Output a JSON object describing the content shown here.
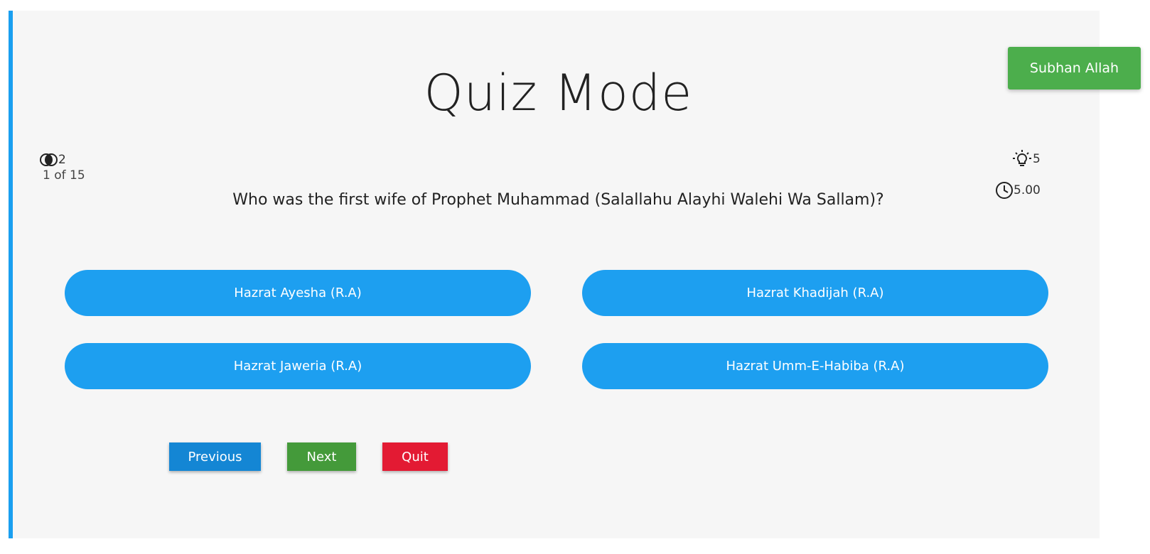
{
  "quiz": {
    "title": "Quiz Mode",
    "attempts": "2",
    "hints": "5",
    "progress": "1 of 15",
    "timer": "5.00",
    "question": "Who was the first wife of Prophet Muhammad (Salallahu Alayhi Walehi Wa Sallam)?",
    "options": [
      "Hazrat Ayesha (R.A)",
      "Hazrat Khadijah (R.A)",
      "Hazrat Jaweria (R.A)",
      "Hazrat Umm-E-Habiba (R.A)"
    ]
  },
  "nav": {
    "previous": "Previous",
    "next": "Next",
    "quit": "Quit"
  },
  "toast": {
    "message": "Subhan Allah"
  },
  "icons": {
    "attempts": "circles-icon",
    "hints": "lightbulb-icon",
    "timer": "clock-icon"
  },
  "colors": {
    "accent_blue": "#1d9ff0",
    "previous": "#1486d4",
    "next": "#449a3a",
    "quit": "#e31a33",
    "toast": "#4cae4c",
    "panel_bg": "#f6f6f6"
  }
}
